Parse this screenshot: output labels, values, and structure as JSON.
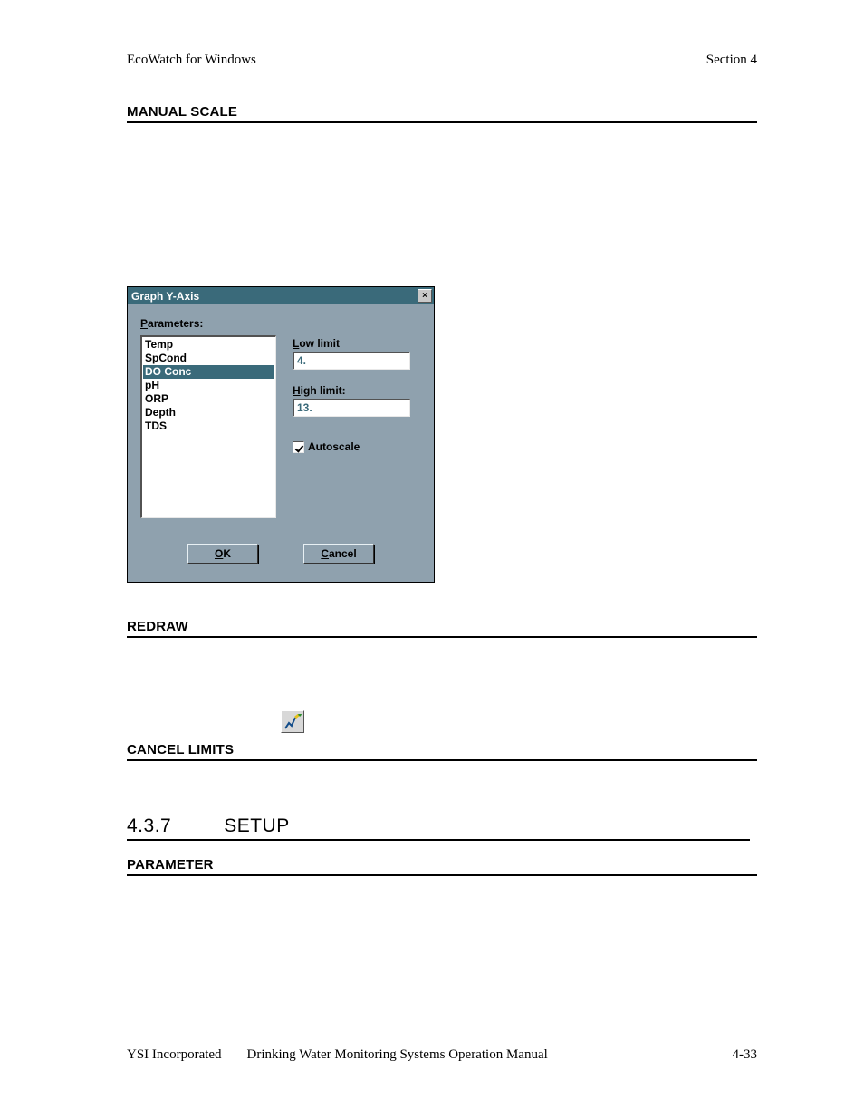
{
  "header": {
    "left": "EcoWatch for Windows",
    "right": "Section 4"
  },
  "headings": {
    "manual_scale": "MANUAL SCALE",
    "redraw": "REDRAW",
    "cancel_limits": "CANCEL LIMITS",
    "setup_num": "4.3.7",
    "setup_text": "SETUP",
    "parameter": "PARAMETER"
  },
  "dialog": {
    "title": "Graph Y-Axis",
    "close_glyph": "×",
    "parameters_label_pre": "P",
    "parameters_label_rest": "arameters:",
    "items": [
      "Temp",
      "SpCond",
      "DO Conc",
      "pH",
      "ORP",
      "Depth",
      "TDS"
    ],
    "selected_index": 2,
    "low_pre": "L",
    "low_rest": "ow limit",
    "low_value": "4.",
    "high_pre": "H",
    "high_rest": "igh limit:",
    "high_value": "13.",
    "autoscale_pre": "A",
    "autoscale_rest": "utoscale",
    "autoscale_checked": true,
    "ok_pre": "O",
    "ok_rest": "K",
    "cancel_pre": "C",
    "cancel_rest": "ancel"
  },
  "footer": {
    "company": "YSI Incorporated",
    "manual": "Drinking Water Monitoring Systems Operation Manual",
    "page": "4-33"
  }
}
